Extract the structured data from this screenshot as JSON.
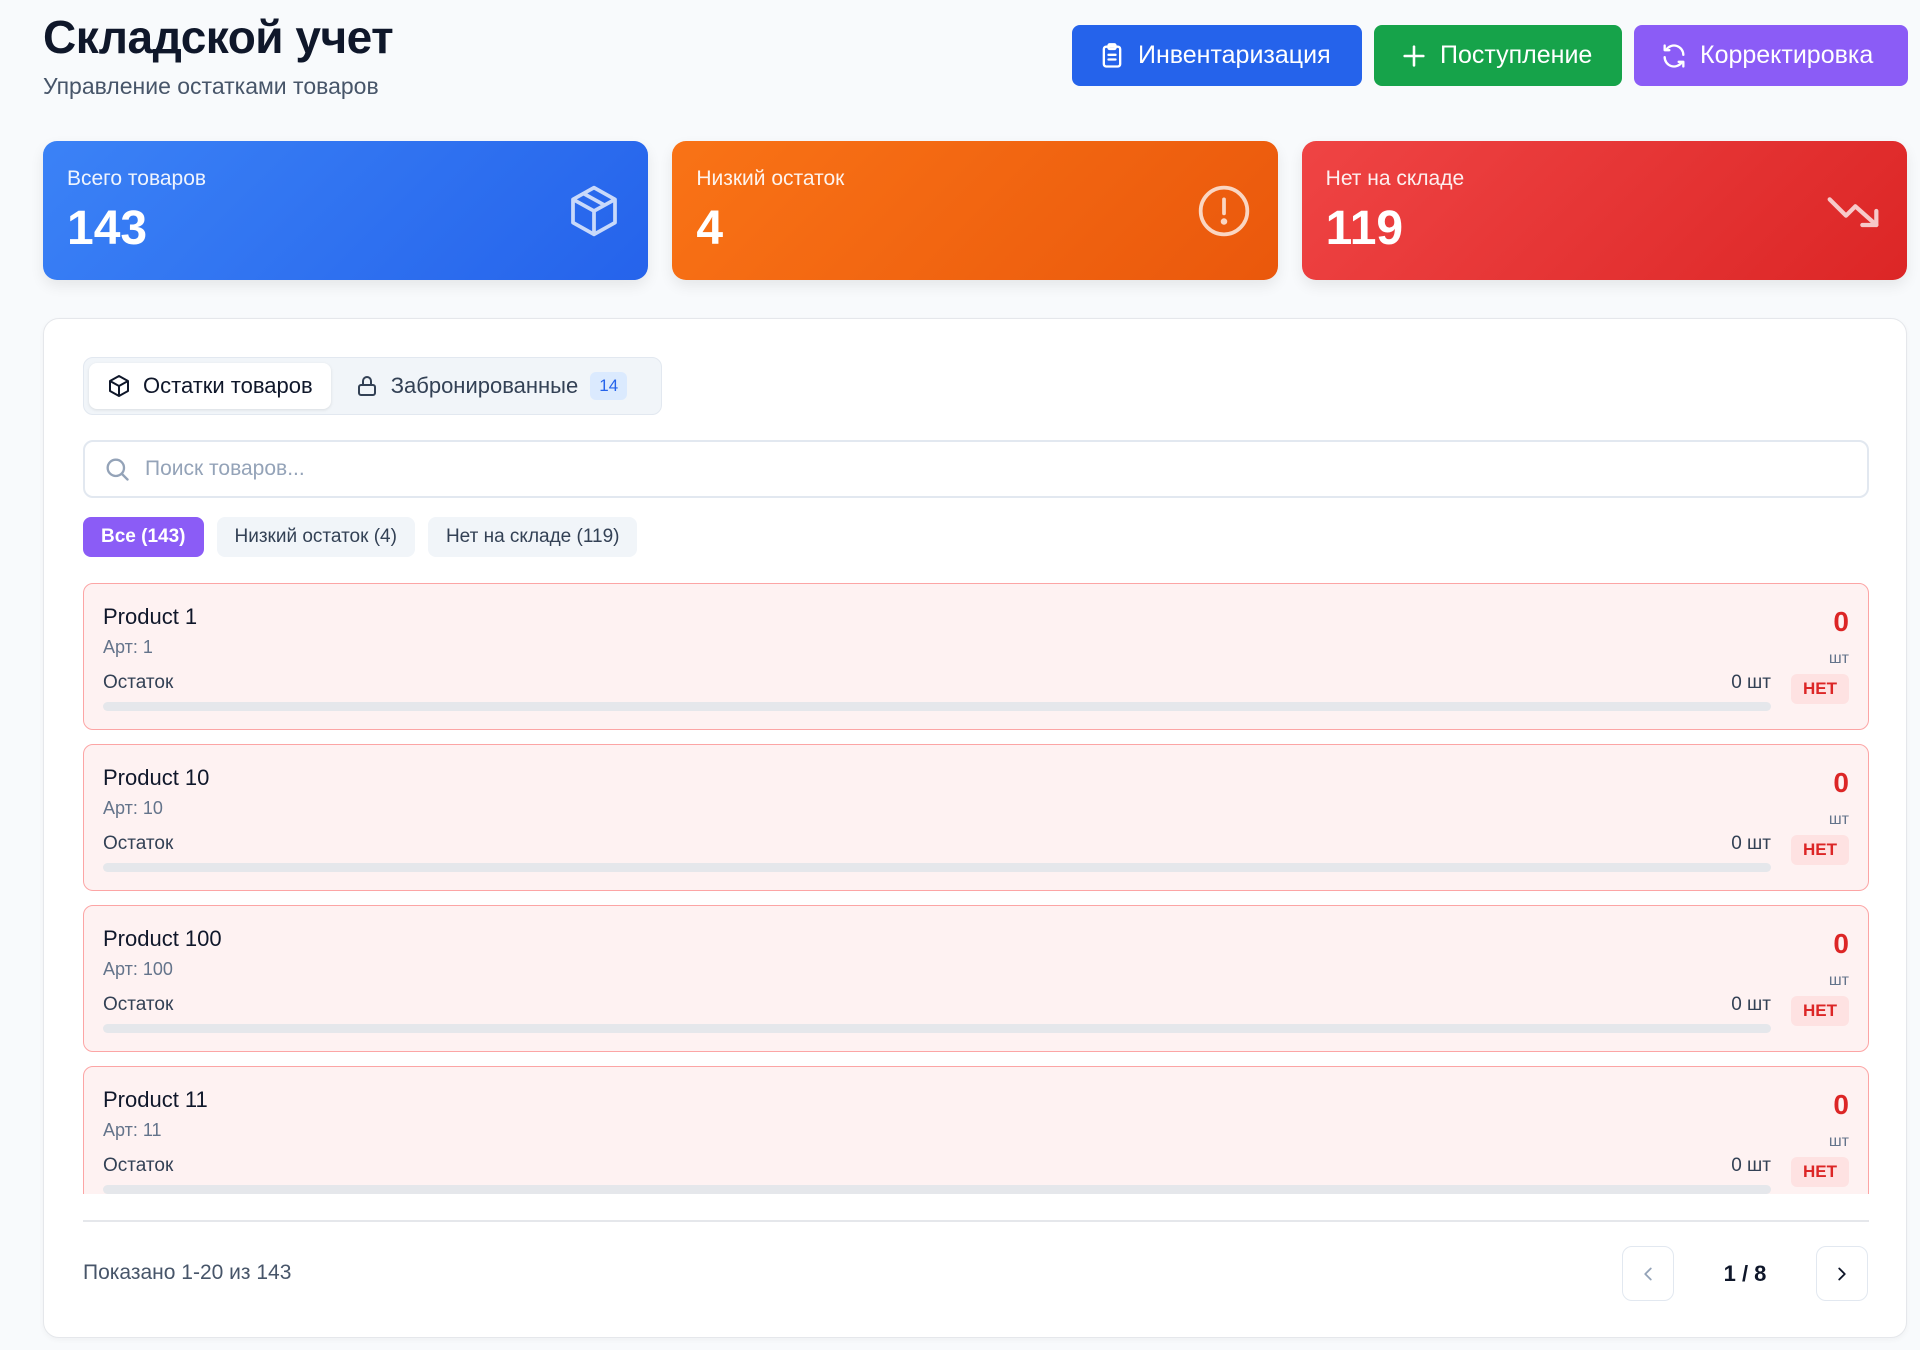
{
  "header": {
    "title": "Складской учет",
    "subtitle": "Управление остатками товаров"
  },
  "actions": {
    "inventory_label": "Инвентаризация",
    "receipt_label": "Поступление",
    "adjustment_label": "Корректировка"
  },
  "stats": [
    {
      "label": "Всего товаров",
      "value": "143",
      "icon": "package-icon"
    },
    {
      "label": "Низкий остаток",
      "value": "4",
      "icon": "alert-circle-icon"
    },
    {
      "label": "Нет на складе",
      "value": "119",
      "icon": "trending-down-icon"
    }
  ],
  "tabs": {
    "stock_label": "Остатки товаров",
    "reserved_label": "Забронированные",
    "reserved_count": "14"
  },
  "search": {
    "placeholder": "Поиск товаров..."
  },
  "filters": {
    "all": "Все (143)",
    "low": "Низкий остаток (4)",
    "out": "Нет на складе (119)"
  },
  "items": [
    {
      "name": "Product 1",
      "sku": "Арт: 1",
      "stock_label": "Остаток",
      "stock_value": "0 шт",
      "qty": "0",
      "unit": "шт",
      "status": "НЕТ",
      "fill": 0
    },
    {
      "name": "Product 10",
      "sku": "Арт: 10",
      "stock_label": "Остаток",
      "stock_value": "0 шт",
      "qty": "0",
      "unit": "шт",
      "status": "НЕТ",
      "fill": 0
    },
    {
      "name": "Product 100",
      "sku": "Арт: 100",
      "stock_label": "Остаток",
      "stock_value": "0 шт",
      "qty": "0",
      "unit": "шт",
      "status": "НЕТ",
      "fill": 0
    },
    {
      "name": "Product 11",
      "sku": "Арт: 11",
      "stock_label": "Остаток",
      "stock_value": "0 шт",
      "qty": "0",
      "unit": "шт",
      "status": "НЕТ",
      "fill": 0
    }
  ],
  "footer": {
    "showing": "Показано 1-20 из 143",
    "page": "1 / 8"
  },
  "colors": {
    "primary_blue": "#2563eb",
    "success_green": "#16a34a",
    "accent_purple": "#8b5cf6",
    "warning_orange": "#f97316",
    "danger_red": "#dc2626"
  }
}
